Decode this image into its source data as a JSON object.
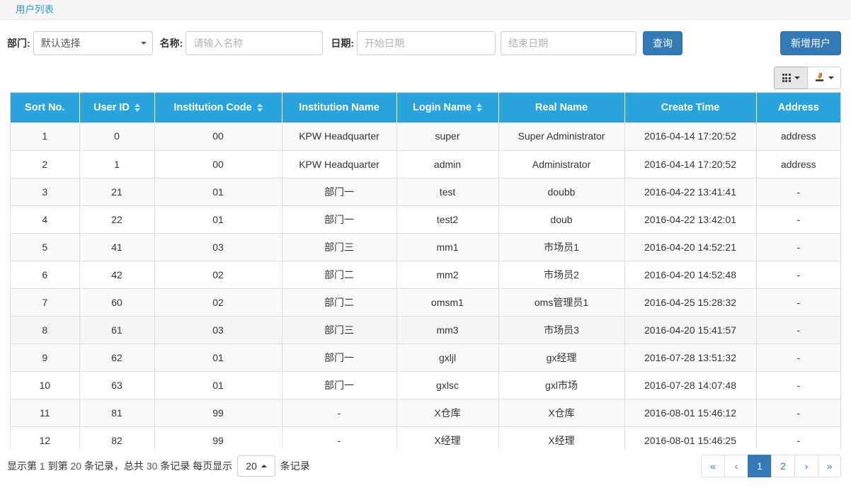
{
  "tabs": [
    {
      "label": "用户列表",
      "active": true
    }
  ],
  "filter": {
    "dept_label": "部门:",
    "dept_value": "默认选择",
    "name_label": "名称:",
    "name_value": "",
    "name_placeholder": "请输入名称",
    "date_label": "日期:",
    "start_date_value": "",
    "start_date_placeholder": "开始日期",
    "end_date_value": "",
    "end_date_placeholder": "结束日期",
    "query_button": "查询",
    "add_user_button": "新增用户"
  },
  "toolbar": {
    "columns_icon": "grid-icon",
    "export_icon": "export-icon"
  },
  "table": {
    "columns": [
      {
        "label": "Sort No.",
        "sortable": false
      },
      {
        "label": "User ID",
        "sortable": true
      },
      {
        "label": "Institution Code",
        "sortable": true
      },
      {
        "label": "Institution Name",
        "sortable": false
      },
      {
        "label": "Login Name",
        "sortable": true
      },
      {
        "label": "Real Name",
        "sortable": false
      },
      {
        "label": "Create Time",
        "sortable": false
      },
      {
        "label": "Address",
        "sortable": false
      }
    ],
    "rows": [
      [
        "1",
        "0",
        "00",
        "KPW Headquarter",
        "super",
        "Super Administrator",
        "2016-04-14 17:20:52",
        "address"
      ],
      [
        "2",
        "1",
        "00",
        "KPW Headquarter",
        "admin",
        "Administrator",
        "2016-04-14 17:20:52",
        "address"
      ],
      [
        "3",
        "21",
        "01",
        "部门一",
        "test",
        "doubb",
        "2016-04-22 13:41:41",
        "-"
      ],
      [
        "4",
        "22",
        "01",
        "部门一",
        "test2",
        "doub",
        "2016-04-22 13:42:01",
        "-"
      ],
      [
        "5",
        "41",
        "03",
        "部门三",
        "mm1",
        "市场员1",
        "2016-04-20 14:52:21",
        "-"
      ],
      [
        "6",
        "42",
        "02",
        "部门二",
        "mm2",
        "市场员2",
        "2016-04-20 14:52:48",
        "-"
      ],
      [
        "7",
        "60",
        "02",
        "部门二",
        "omsm1",
        "oms管理员1",
        "2016-04-25 15:28:32",
        "-"
      ],
      [
        "8",
        "61",
        "03",
        "部门三",
        "mm3",
        "市场员3",
        "2016-04-20 15:41:57",
        "-"
      ],
      [
        "9",
        "62",
        "01",
        "部门一",
        "gxljl",
        "gx经理",
        "2016-07-28 13:51:32",
        "-"
      ],
      [
        "10",
        "63",
        "01",
        "部门一",
        "gxlsc",
        "gxl市场",
        "2016-07-28 14:07:48",
        "-"
      ],
      [
        "11",
        "81",
        "99",
        "-",
        "X仓库",
        "X仓库",
        "2016-08-01 15:46:12",
        "-"
      ],
      [
        "12",
        "82",
        "99",
        "-",
        "X经理",
        "X经理",
        "2016-08-01 15:46:25",
        "-"
      ]
    ],
    "hovered_row_index": 7
  },
  "footer": {
    "info_prefix": "显示第",
    "from": "1",
    "info_mid1": "到第",
    "to": "20",
    "info_mid2": "条记录，总共",
    "total": "30",
    "info_mid3": "条记录 每页显示",
    "page_size": "20",
    "info_suffix": "条记录",
    "pagination": [
      {
        "label": "«",
        "name": "first",
        "active": false
      },
      {
        "label": "‹",
        "name": "prev",
        "active": false
      },
      {
        "label": "1",
        "name": "page-1",
        "active": true
      },
      {
        "label": "2",
        "name": "page-2",
        "active": false
      },
      {
        "label": "›",
        "name": "next",
        "active": false
      },
      {
        "label": "»",
        "name": "last",
        "active": false
      }
    ]
  },
  "colors": {
    "tab_text": "#2e9ad0",
    "table_header_bg": "#29a3dc",
    "primary_button": "#337ab7"
  }
}
